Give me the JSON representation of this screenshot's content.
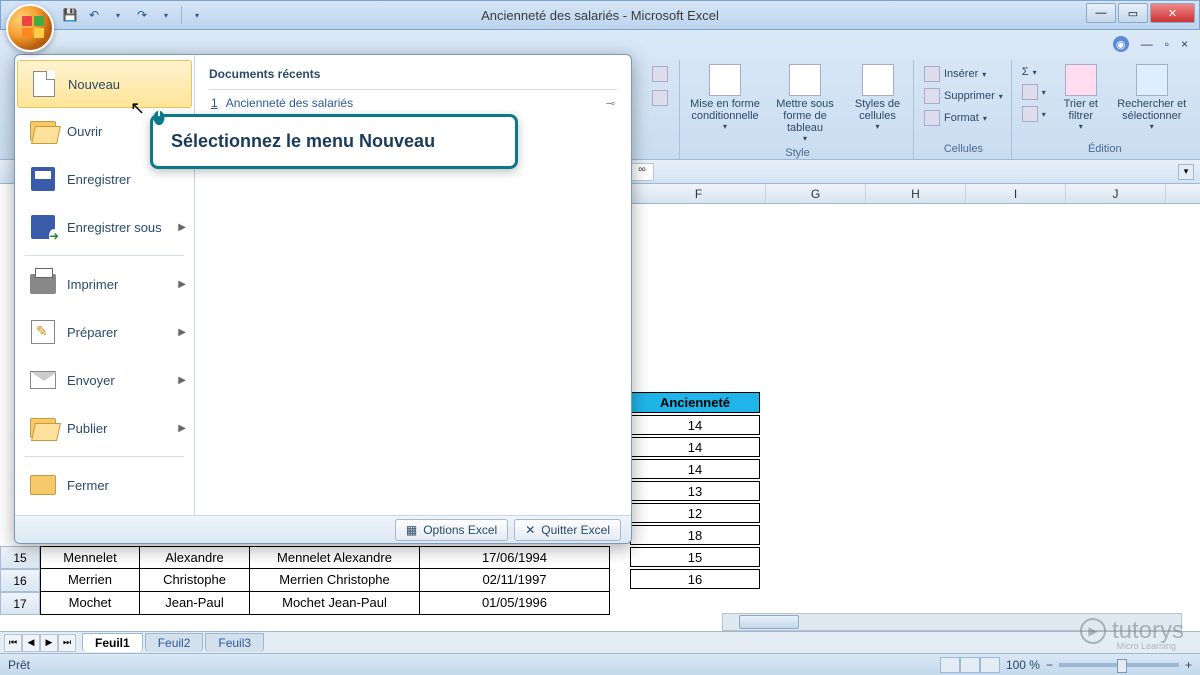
{
  "window": {
    "title": "Ancienneté des salariés - Microsoft Excel"
  },
  "qat": {
    "save": "Enregistrer",
    "undo": "Annuler",
    "redo": "Rétablir"
  },
  "ribbon": {
    "help_icon": "?",
    "groups": {
      "number_extra": "000",
      "style": {
        "label": "Style",
        "cond_format": "Mise en forme conditionnelle",
        "as_table": "Mettre sous forme de tableau",
        "cell_styles": "Styles de cellules"
      },
      "cells": {
        "label": "Cellules",
        "insert": "Insérer",
        "delete": "Supprimer",
        "format": "Format"
      },
      "editing": {
        "label": "Édition",
        "sigma": "Σ",
        "sort_filter": "Trier et filtrer",
        "find_select": "Rechercher et sélectionner"
      }
    }
  },
  "office_menu": {
    "items": {
      "new": "Nouveau",
      "open": "Ouvrir",
      "save": "Enregistrer",
      "save_as": "Enregistrer sous",
      "print": "Imprimer",
      "prepare": "Préparer",
      "send": "Envoyer",
      "publish": "Publier",
      "close": "Fermer"
    },
    "recent_title": "Documents récents",
    "recent": [
      {
        "index": "1",
        "name": "Ancienneté des salariés"
      }
    ],
    "footer": {
      "options": "Options Excel",
      "quit": "Quitter Excel"
    }
  },
  "callout": {
    "text": "Sélectionnez le menu Nouveau"
  },
  "columns": [
    "F",
    "G",
    "H",
    "I",
    "J"
  ],
  "anc_header": "Ancienneté",
  "anc_values": [
    "14",
    "14",
    "14",
    "13",
    "12",
    "18",
    "15",
    "16"
  ],
  "visible_rows": [
    {
      "num": "15",
      "c1": "Mennelet",
      "c2": "Alexandre",
      "c3": "Mennelet Alexandre",
      "c4": "17/06/1994",
      "c5": "18"
    },
    {
      "num": "16",
      "c1": "Merrien",
      "c2": "Christophe",
      "c3": "Merrien Christophe",
      "c4": "02/11/1997",
      "c5": "15"
    },
    {
      "num": "17",
      "c1": "Mochet",
      "c2": "Jean-Paul",
      "c3": "Mochet Jean-Paul",
      "c4": "01/05/1996",
      "c5": "16"
    }
  ],
  "sheets": {
    "tabs": [
      "Feuil1",
      "Feuil2",
      "Feuil3"
    ],
    "active": 0
  },
  "status": {
    "ready": "Prêt",
    "zoom": "100 %"
  },
  "watermark": {
    "brand": "tutorys",
    "sub": "Micro Learning"
  }
}
